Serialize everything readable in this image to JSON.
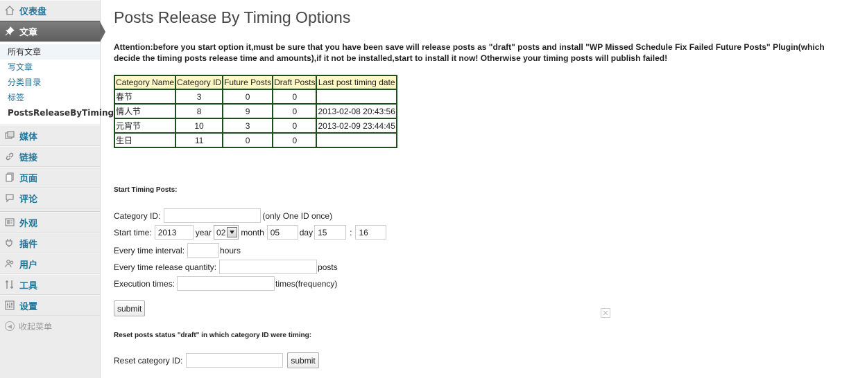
{
  "sidebar": {
    "items_top": [
      {
        "label": "仪表盘",
        "icon": "dashboard-icon"
      }
    ],
    "active": {
      "label": "文章",
      "icon": "pushpin-icon"
    },
    "submenu": [
      "所有文章",
      "写文章",
      "分类目录",
      "标签",
      "PostsReleaseByTiming"
    ],
    "items_middle": [
      {
        "label": "媒体",
        "icon": "media-icon"
      },
      {
        "label": "链接",
        "icon": "link-icon"
      },
      {
        "label": "页面",
        "icon": "pages-icon"
      },
      {
        "label": "评论",
        "icon": "comment-icon"
      }
    ],
    "items_bottom": [
      {
        "label": "外观",
        "icon": "appearance-icon"
      },
      {
        "label": "插件",
        "icon": "plugin-icon"
      },
      {
        "label": "用户",
        "icon": "users-icon"
      },
      {
        "label": "工具",
        "icon": "tools-icon"
      },
      {
        "label": "设置",
        "icon": "settings-icon"
      }
    ],
    "collapse": "收起菜单"
  },
  "page": {
    "title": "Posts Release By Timing Options",
    "attention": "Attention:before you start option it,must be sure that you have been save will release posts as \"draft\" posts and install \"WP Missed Schedule Fix Failed Future Posts\" Plugin(which decide the timing posts release time and amounts),if it not be installed,start to install it now! Otherwise your timing posts will publish failed!"
  },
  "table": {
    "headers": [
      "Category Name",
      "Category ID",
      "Future Posts",
      "Draft Posts",
      "Last post timing date"
    ],
    "rows": [
      [
        "春节",
        "3",
        "0",
        "0",
        ""
      ],
      [
        "情人节",
        "8",
        "9",
        "0",
        "2013-02-08 20:43:56"
      ],
      [
        "元宵节",
        "10",
        "3",
        "0",
        "2013-02-09 23:44:45"
      ],
      [
        "生日",
        "11",
        "0",
        "0",
        ""
      ]
    ]
  },
  "form": {
    "section_title": "Start Timing Posts:",
    "category_id_label": "Category ID:",
    "category_id_value": "",
    "category_id_hint": "(only One ID once)",
    "start_time_label": "Start time:",
    "year_value": "2013",
    "year_label": "year",
    "month_value": "02",
    "month_label": "month",
    "day_value": "05",
    "day_label": "day",
    "hour_value": "15",
    "time_sep": ":",
    "minute_value": "16",
    "interval_label": "Every time interval:",
    "interval_value": "",
    "interval_unit": "hours",
    "quantity_label": "Every time release quantity:",
    "quantity_value": "",
    "quantity_unit": "posts",
    "exec_label": "Execution times:",
    "exec_value": "",
    "exec_unit": "times(frequency)",
    "submit_label": "submit",
    "close_glyph": "✕"
  },
  "reset": {
    "section_title": "Reset posts status \"draft\" in which category ID were timing:",
    "label": "Reset category ID:",
    "value": "",
    "submit_label": "submit"
  },
  "colors": {
    "table_border": "#1e4d1e",
    "table_header_bg": "#fff7c4",
    "sidebar_link": "#21759b"
  }
}
